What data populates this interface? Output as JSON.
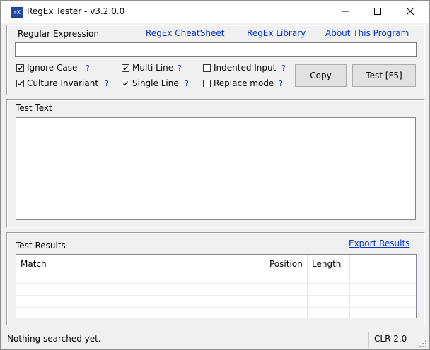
{
  "window": {
    "icon_text": "rX",
    "title": "RegEx Tester - v3.2.0.0"
  },
  "regex_panel": {
    "label": "Regular Expression",
    "links": {
      "cheatsheet": "RegEx CheatSheet",
      "library": "RegEx Library",
      "about": "About This Program"
    },
    "pattern_value": "",
    "options": [
      {
        "label": "Ignore Case",
        "checked": true,
        "help": "?"
      },
      {
        "label": "Multi Line",
        "checked": true,
        "help": "?"
      },
      {
        "label": "Indented Input",
        "checked": false,
        "help": "?"
      },
      {
        "label": "Culture Invariant",
        "checked": true,
        "help": "?"
      },
      {
        "label": "Single Line",
        "checked": true,
        "help": "?"
      },
      {
        "label": "Replace mode",
        "checked": false,
        "help": "?"
      }
    ],
    "copy_label": "Copy",
    "test_label": "Test [F5]"
  },
  "test_text_panel": {
    "label": "Test Text",
    "value": ""
  },
  "results_panel": {
    "label": "Test Results",
    "export_label": "Export Results",
    "columns": [
      "Match",
      "Position",
      "Length"
    ],
    "rows": []
  },
  "statusbar": {
    "message": "Nothing searched yet.",
    "runtime": "CLR 2.0"
  }
}
